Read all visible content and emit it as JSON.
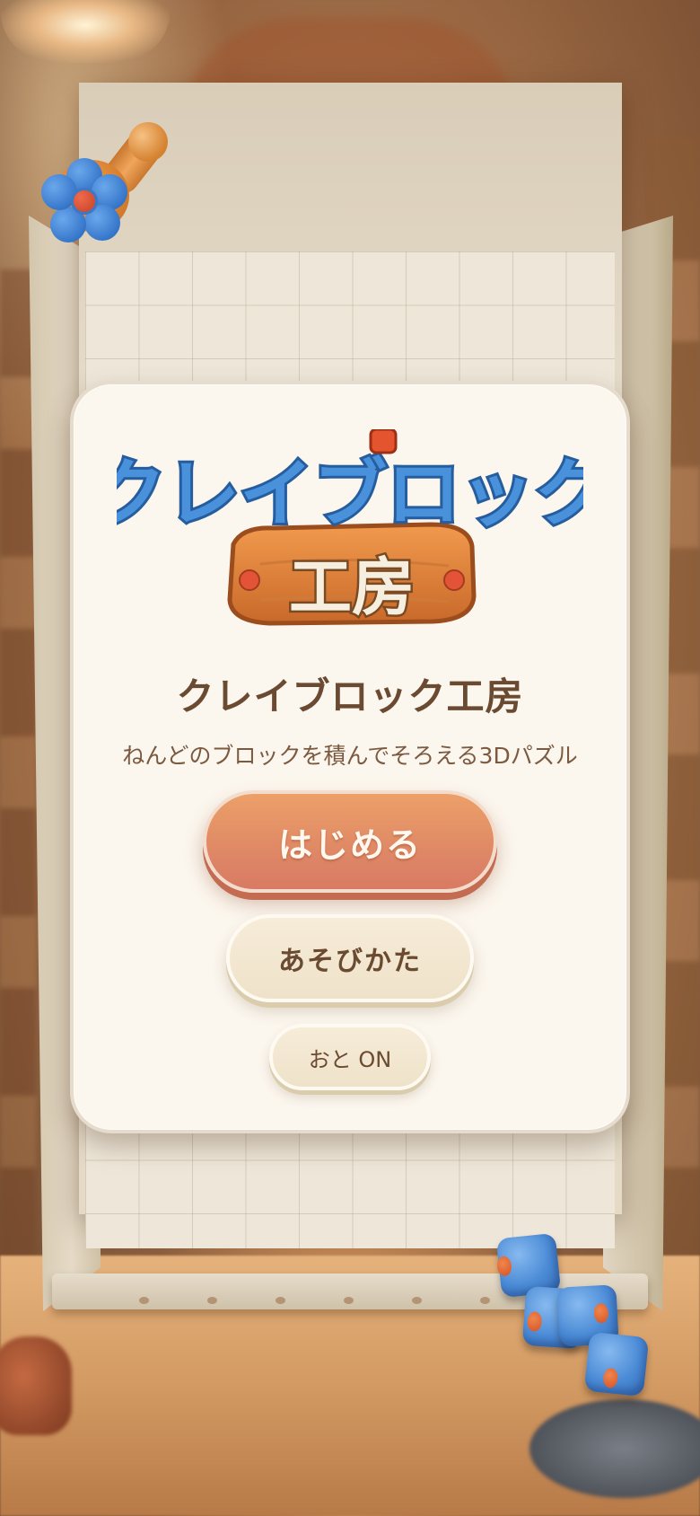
{
  "app": {
    "logo_line1": "クレイブロック",
    "logo_line2": "工房",
    "title": "クレイブロック工房",
    "subtitle": "ねんどのブロックを積んでそろえる3Dパズル"
  },
  "menu": {
    "start_label": "はじめる",
    "howto_label": "あそびかた",
    "sound_label": "おと ON"
  },
  "colors": {
    "accent_orange": "#df8866",
    "clay_blue": "#4b8bd6",
    "clay_orange": "#f0a65c",
    "text_brown": "#6b4a32",
    "card_bg": "#fbf6ee"
  },
  "icons": {
    "stamp": "flower-stamp-icon",
    "blocks": "clay-block-piece-icon"
  }
}
